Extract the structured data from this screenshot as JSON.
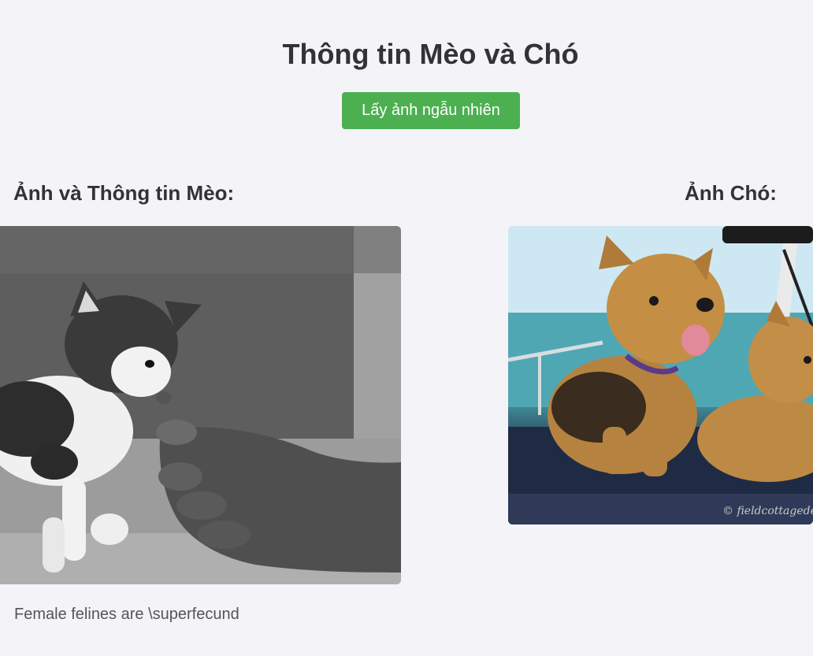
{
  "header": {
    "title": "Thông tin Mèo và Chó",
    "random_button_label": "Lấy ảnh ngẫu nhiên"
  },
  "cat_section": {
    "heading": "Ảnh và Thông tin Mèo:",
    "fact": "Female felines are \\superfecund"
  },
  "dog_section": {
    "heading": "Ảnh Chó:",
    "watermark": "© fieldcottagede"
  },
  "colors": {
    "background": "#f4f4f8",
    "button": "#4caf50",
    "button_text": "#ffffff",
    "heading_text": "#333333",
    "fact_text": "#555555"
  }
}
